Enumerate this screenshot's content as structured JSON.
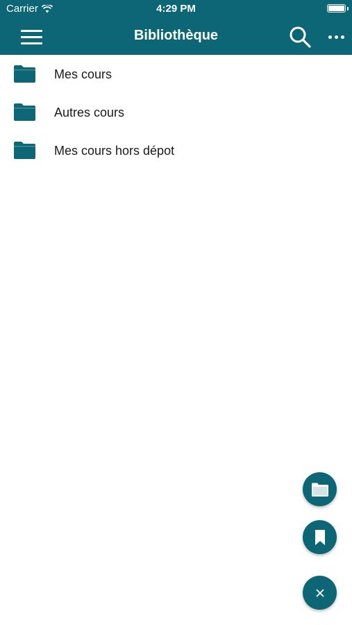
{
  "status_bar": {
    "carrier": "Carrier",
    "time": "4:29 PM",
    "battery_level": 1.0
  },
  "nav_bar": {
    "title": "Bibliothèque",
    "left_icon": "hamburger-menu-icon",
    "right_icons": [
      "search-icon",
      "more-horizontal-icon"
    ]
  },
  "folders": [
    {
      "label": "Mes cours",
      "icon": "folder-icon"
    },
    {
      "label": "Autres cours",
      "icon": "folder-icon"
    },
    {
      "label": "Mes cours hors dépot",
      "icon": "folder-icon"
    }
  ],
  "fabs": [
    {
      "icon": "folder-icon"
    },
    {
      "icon": "bookmark-icon"
    },
    {
      "icon": "close-icon"
    }
  ],
  "colors": {
    "primary": "#0c6675",
    "background": "#ffffff",
    "text": "#1a1a1a"
  }
}
